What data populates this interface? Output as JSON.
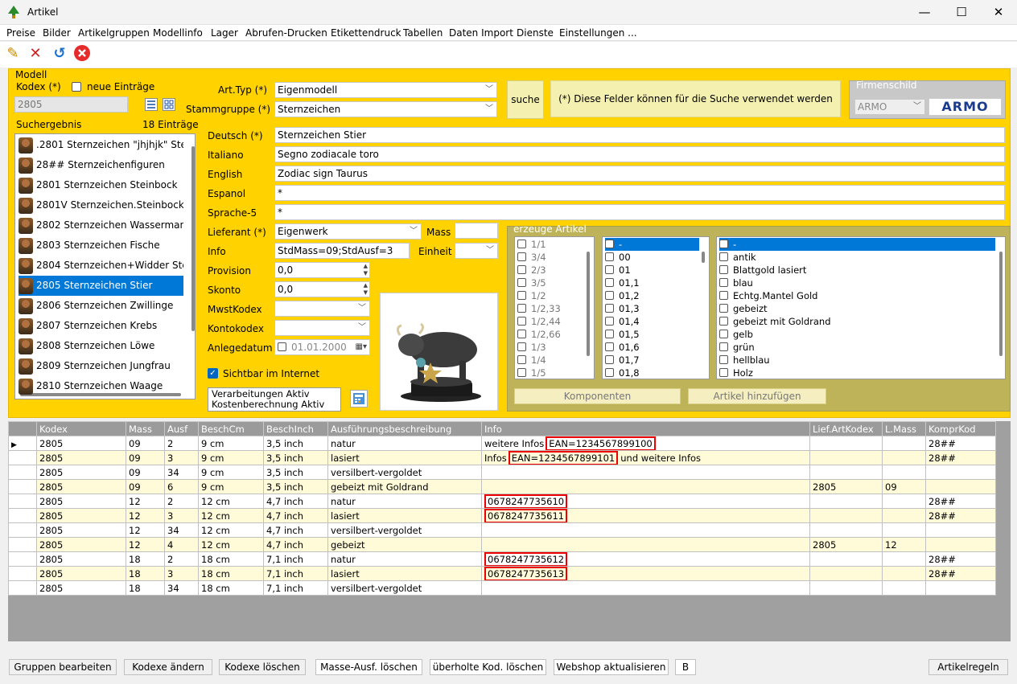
{
  "window": {
    "title": "Artikel",
    "minimize": "—",
    "maximize": "☐",
    "close": "✕"
  },
  "menu": [
    "Preise",
    "Bilder",
    "Artikelgruppen",
    "Modellinfo",
    "Lager",
    "Abrufen-Drucken",
    "Etikettendruck",
    "Tabellen",
    "Daten Import",
    "Dienste",
    "Einstellungen ..."
  ],
  "toolbar": [
    "pencil-icon",
    "delete-x-icon",
    "undo-icon",
    "cancel-circle-icon"
  ],
  "modell": {
    "group_label": "Modell",
    "kodex_label": "Kodex (*)",
    "neue_label": "neue Einträge",
    "kodex_value": "2805",
    "suchergebnis_label": "Suchergebnis",
    "count_label": "18 Einträge",
    "results": [
      ".2801 Sternzeichen \"jhjhjk\" Ste",
      "28## Sternzeichenfiguren",
      "2801 Sternzeichen Steinbock",
      "2801V Sternzeichen.Steinbock.",
      "2802 Sternzeichen Wasserman",
      "2803 Sternzeichen Fische",
      "2804 Sternzeichen+Widder Ste",
      "2805 Sternzeichen Stier",
      "2806 Sternzeichen Zwillinge",
      "2807 Sternzeichen Krebs",
      "2808 Sternzeichen Löwe",
      "2809 Sternzeichen Jungfrau",
      "2810 Sternzeichen Waage"
    ],
    "selected_index": 7
  },
  "form": {
    "arttyp_label": "Art.Typ (*)",
    "arttyp_value": "Eigenmodell",
    "stammgruppe_label": "Stammgruppe (*)",
    "stammgruppe_value": "Sternzeichen",
    "suche_label": "suche",
    "hint": "(*) Diese Felder können für die Suche verwendet werden",
    "firmenschild_label": "Firmenschild",
    "firmenschild_value": "ARMO",
    "logo_text": "ARMO",
    "deutsch_label": "Deutsch (*)",
    "deutsch_value": "Sternzeichen Stier",
    "italiano_label": "Italiano",
    "italiano_value": "Segno zodiacale toro",
    "english_label": "English",
    "english_value": "Zodiac sign Taurus",
    "espanol_label": "Espanol",
    "espanol_value": "*",
    "sprache5_label": "Sprache-5",
    "sprache5_value": "*",
    "lieferant_label": "Lieferant (*)",
    "lieferant_value": "Eigenwerk",
    "mass_label": "Mass",
    "info_label": "Info",
    "info_value": "StdMass=09;StdAusf=3",
    "einheit_label": "Einheit",
    "provision_label": "Provision",
    "provision_value": "0,0",
    "skonto_label": "Skonto",
    "skonto_value": "0,0",
    "mwst_label": "MwstKodex",
    "konto_label": "Kontokodex",
    "anlege_label": "Anlegedatum",
    "anlege_value": "01.01.2000",
    "sichtbar_label": "Sichtbar im Internet",
    "verarb_line1": "Verarbeitungen Aktiv",
    "verarb_line2": "Kostenberechnung Aktiv"
  },
  "erzeuge": {
    "label": "erzeuge Artikel",
    "list1": [
      "1/1",
      "3/4",
      "2/3",
      "3/5",
      "1/2",
      "1/2,33",
      "1/2,44",
      "1/2,66",
      "1/3",
      "1/4",
      "1/5"
    ],
    "list2": [
      "-",
      "00",
      "01",
      "01,1",
      "01,2",
      "01,3",
      "01,4",
      "01,5",
      "01,6",
      "01,7",
      "01,8"
    ],
    "list3": [
      "-",
      "antik",
      "Blattgold lasiert",
      "blau",
      "Echtg.Mantel Gold",
      "gebeizt",
      "gebeizt mit Goldrand",
      "gelb",
      "grün",
      "hellblau",
      "Holz"
    ],
    "komponenten_label": "Komponenten",
    "hinzufuegen_label": "Artikel hinzufügen"
  },
  "grid": {
    "columns": [
      "Kodex",
      "Mass",
      "Ausf",
      "BeschCm",
      "BeschInch",
      "Ausführungsbeschreibung",
      "Info",
      "Lief.ArtKodex",
      "L.Mass",
      "KomprKod"
    ],
    "rows": [
      {
        "kodex": "2805",
        "mass": "09",
        "ausf": "2",
        "cm": "9 cm",
        "inch": "3,5 inch",
        "desc": "natur",
        "info_pre": "weitere Infos",
        "ean": "EAN=1234567899100",
        "info_post": "",
        "lief": "",
        "lmass": "",
        "kompr": "28##"
      },
      {
        "kodex": "2805",
        "mass": "09",
        "ausf": "3",
        "cm": "9 cm",
        "inch": "3,5 inch",
        "desc": "lasiert",
        "info_pre": "Infos",
        "ean": "EAN=1234567899101",
        "info_post": "und weitere Infos",
        "lief": "",
        "lmass": "",
        "kompr": "28##"
      },
      {
        "kodex": "2805",
        "mass": "09",
        "ausf": "34",
        "cm": "9 cm",
        "inch": "3,5 inch",
        "desc": "versilbert-vergoldet",
        "info_pre": "",
        "ean": "",
        "info_post": "",
        "lief": "",
        "lmass": "",
        "kompr": ""
      },
      {
        "kodex": "2805",
        "mass": "09",
        "ausf": "6",
        "cm": "9 cm",
        "inch": "3,5 inch",
        "desc": "gebeizt mit Goldrand",
        "info_pre": "",
        "ean": "",
        "info_post": "",
        "lief": "2805",
        "lmass": "09",
        "kompr": ""
      },
      {
        "kodex": "2805",
        "mass": "12",
        "ausf": "2",
        "cm": "12 cm",
        "inch": "4,7 inch",
        "desc": "natur",
        "info_pre": "",
        "ean": "0678247735610",
        "info_post": "",
        "lief": "",
        "lmass": "",
        "kompr": "28##"
      },
      {
        "kodex": "2805",
        "mass": "12",
        "ausf": "3",
        "cm": "12 cm",
        "inch": "4,7 inch",
        "desc": "lasiert",
        "info_pre": "",
        "ean": "0678247735611",
        "info_post": "",
        "lief": "",
        "lmass": "",
        "kompr": "28##"
      },
      {
        "kodex": "2805",
        "mass": "12",
        "ausf": "34",
        "cm": "12 cm",
        "inch": "4,7 inch",
        "desc": "versilbert-vergoldet",
        "info_pre": "",
        "ean": "",
        "info_post": "",
        "lief": "",
        "lmass": "",
        "kompr": ""
      },
      {
        "kodex": "2805",
        "mass": "12",
        "ausf": "4",
        "cm": "12 cm",
        "inch": "4,7 inch",
        "desc": "gebeizt",
        "info_pre": "",
        "ean": "",
        "info_post": "",
        "lief": "2805",
        "lmass": "12",
        "kompr": ""
      },
      {
        "kodex": "2805",
        "mass": "18",
        "ausf": "2",
        "cm": "18 cm",
        "inch": "7,1 inch",
        "desc": "natur",
        "info_pre": "",
        "ean": "0678247735612",
        "info_post": "",
        "lief": "",
        "lmass": "",
        "kompr": "28##"
      },
      {
        "kodex": "2805",
        "mass": "18",
        "ausf": "3",
        "cm": "18 cm",
        "inch": "7,1 inch",
        "desc": "lasiert",
        "info_pre": "",
        "ean": "0678247735613",
        "info_post": "",
        "lief": "",
        "lmass": "",
        "kompr": "28##"
      },
      {
        "kodex": "2805",
        "mass": "18",
        "ausf": "34",
        "cm": "18 cm",
        "inch": "7,1 inch",
        "desc": "versilbert-vergoldet",
        "info_pre": "",
        "ean": "",
        "info_post": "",
        "lief": "",
        "lmass": "",
        "kompr": ""
      }
    ]
  },
  "bottom_buttons": [
    "Gruppen bearbeiten",
    "Kodexe ändern",
    "Kodexe löschen",
    "Masse-Ausf. löschen",
    "überholte Kod. löschen",
    "Webshop aktualisieren",
    "B",
    "Artikelregeln"
  ]
}
